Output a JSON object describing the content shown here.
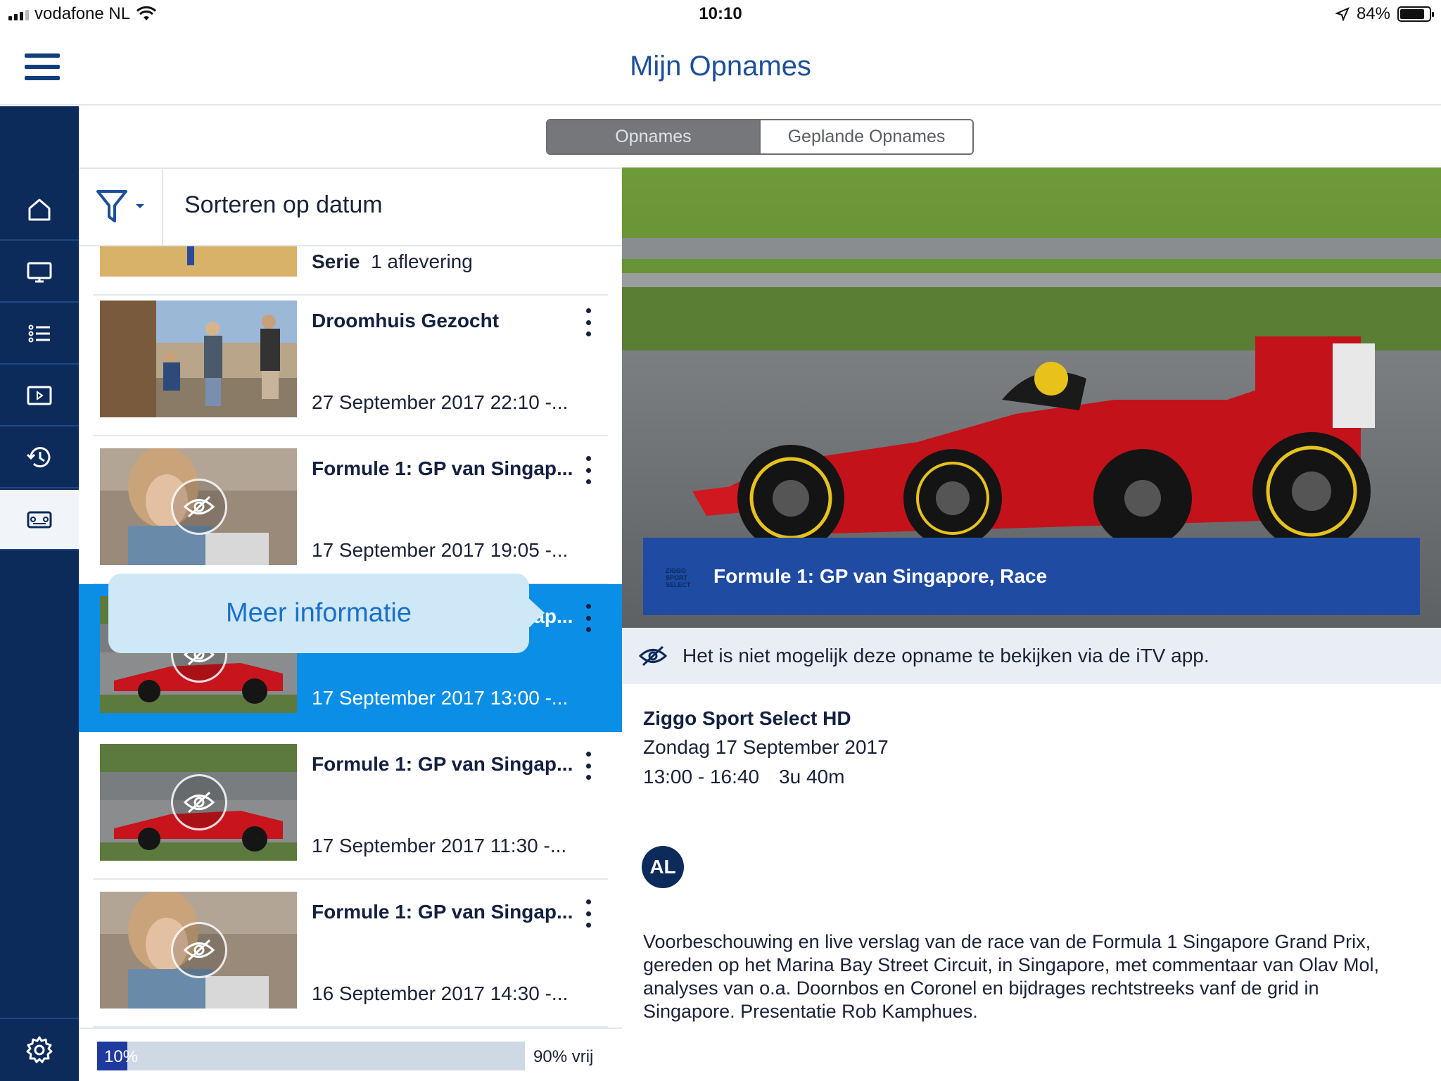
{
  "status_bar": {
    "carrier": "vodafone NL",
    "time": "10:10",
    "battery_pct": "84%"
  },
  "header": {
    "title": "Mijn Opnames",
    "menu_icon": "hamburger-menu-icon"
  },
  "sidebar": {
    "items": [
      {
        "icon": "home-icon"
      },
      {
        "icon": "tv-icon"
      },
      {
        "icon": "list-icon"
      },
      {
        "icon": "play-square-icon"
      },
      {
        "icon": "history-icon"
      },
      {
        "icon": "recordings-icon",
        "active": true
      }
    ],
    "settings_icon": "gear-icon"
  },
  "tabs": {
    "active": "Opnames",
    "inactive": "Geplande Opnames"
  },
  "filter": {
    "icon": "filter-icon",
    "sort_label": "Sorteren op datum"
  },
  "list": {
    "partial_row": {
      "type": "Serie",
      "count": "1 aflevering"
    },
    "items": [
      {
        "title": "Droomhuis Gezocht",
        "date": "27 September 2017  22:10 -..."
      },
      {
        "title": "Formule 1: GP van Singap...",
        "date": "17 September 2017  19:05 -..."
      },
      {
        "title": "Formule 1: GP van Singap...",
        "date": "17 September 2017  13:00 -...",
        "selected": true
      },
      {
        "title": "Formule 1: GP van Singap...",
        "date": "17 September 2017  11:30 -..."
      },
      {
        "title": "Formule 1: GP van Singap...",
        "date": "16 September 2017  14:30 -..."
      }
    ],
    "tooltip": "Meer informatie"
  },
  "storage": {
    "used_label": "10%",
    "used_fraction": 0.07,
    "free_label": "90% vrij"
  },
  "detail": {
    "title": "Formule 1: GP van Singapore, Race",
    "channel_logo_text": "ZIGGO SPORT SELECT",
    "notice": "Het is niet mogelijk deze opname te bekijken via de iTV app.",
    "channel": "Ziggo Sport Select HD",
    "day": "Zondag 17 September 2017",
    "time_range": "13:00 - 16:40",
    "duration": "3u 40m",
    "rating": "AL",
    "description": "Voorbeschouwing en live verslag van de race van de Formula 1 Singapore Grand Prix, gereden op het Marina Bay Street Circuit, in Singapore, met commentaar van Olav Mol, analyses van o.a. Doornbos en Coronel en bijdrages rechtstreeks vanf de grid in Singapore. Presentatie Rob Kamphues."
  },
  "colors": {
    "navy": "#0c2a5a",
    "brand_blue": "#1d4f9a",
    "selected_row": "#0b8fe6",
    "caption_bg": "#1f4ba3"
  }
}
